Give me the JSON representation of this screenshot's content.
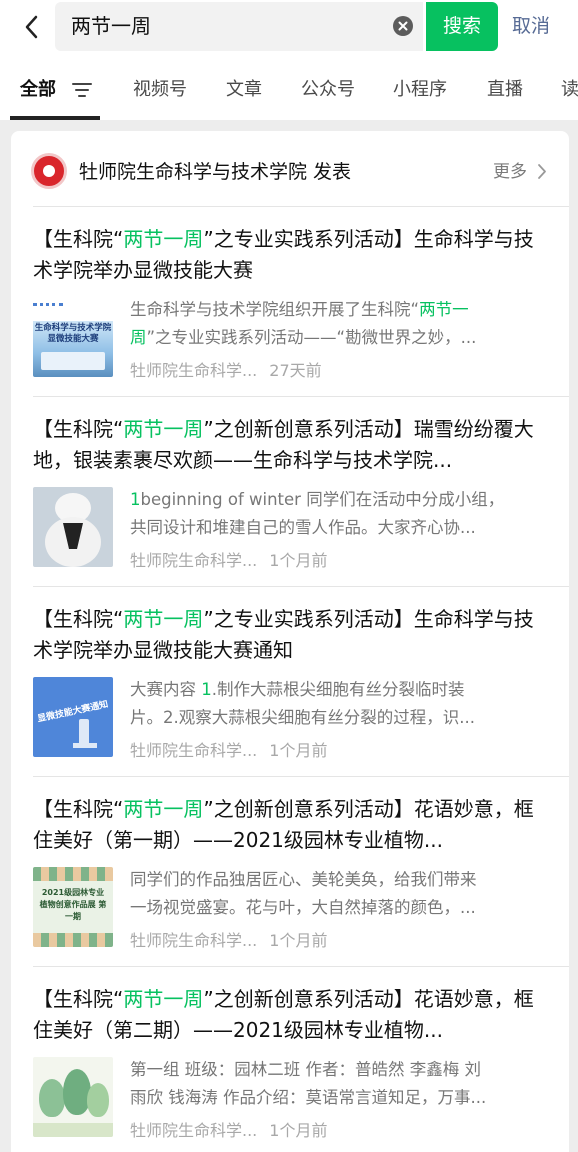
{
  "search": {
    "query": "两节一周",
    "button": "搜索",
    "cancel": "取消"
  },
  "tabs": [
    "全部",
    "视频号",
    "文章",
    "公众号",
    "小程序",
    "直播",
    "读"
  ],
  "account": {
    "name": "牡师院生命科学与技术学院 发表",
    "more": "更多"
  },
  "results": [
    {
      "title_prefix": "【生科院“",
      "title_hl": "两节一周",
      "title_suffix": "”之专业实践系列活动】生命科学与技术学院举办显微技能大赛",
      "snippet_a": "生命科学与技术学院组织开展了生科院“",
      "snippet_hl": "两节一",
      "snippet_b": "周",
      "snippet_c": "”之专业实践系列活动——“勘微世界之妙，...",
      "thumb_text": "生命科学与技术学院 显微技能大赛",
      "source": "牡师院生命科学...",
      "time": "27天前"
    },
    {
      "title_prefix": "【生科院“",
      "title_hl": "两节一周",
      "title_suffix": "”之创新创意系列活动】瑞雪纷纷覆大地，银装素裹尽欢颜——生命科学与技术学院...",
      "snippet_hl": "1",
      "snippet_a": "beginning of winter 同学们在活动中分成小组，",
      "snippet_b": "共同设计和堆建自己的雪人作品。大家齐心协...",
      "source": "牡师院生命科学...",
      "time": "1个月前"
    },
    {
      "title_prefix": "【生科院“",
      "title_hl": "两节一周",
      "title_suffix": "”之专业实践系列活动】生命科学与技术学院举办显微技能大赛通知",
      "snippet_a": "大赛内容 ",
      "snippet_hl": "1",
      "snippet_b": ".制作大蒜根尖细胞有丝分裂临时装",
      "snippet_c": "片。2.观察大蒜根尖细胞有丝分裂的过程，识...",
      "thumb_text": "显微技能大赛通知",
      "source": "牡师院生命科学...",
      "time": "1个月前"
    },
    {
      "title_prefix": "【生科院“",
      "title_hl": "两节一周",
      "title_suffix": "”之创新创意系列活动】花语妙意，框住美好（第一期）——2021级园林专业植物...",
      "snippet_a": "同学们的作品独居匠心、美轮美奂，给我们带来",
      "snippet_b": "一场视觉盛宴。花与叶，大自然掉落的颜色，...",
      "thumb_text": "2021级园林专业 植物创意作品展 第一期",
      "source": "牡师院生命科学...",
      "time": "1个月前"
    },
    {
      "title_prefix": "【生科院“",
      "title_hl": "两节一周",
      "title_suffix": "”之创新创意系列活动】花语妙意，框住美好（第二期）——2021级园林专业植物...",
      "snippet_a": "第一组 班级：园林二班 作者：普皓然 李鑫梅 刘",
      "snippet_b": "雨欣 钱海涛 作品介绍：莫语常言道知足，万事...",
      "source": "牡师院生命科学...",
      "time": "1个月前"
    }
  ],
  "colors": {
    "accent": "#07c160",
    "link": "#576b95"
  }
}
